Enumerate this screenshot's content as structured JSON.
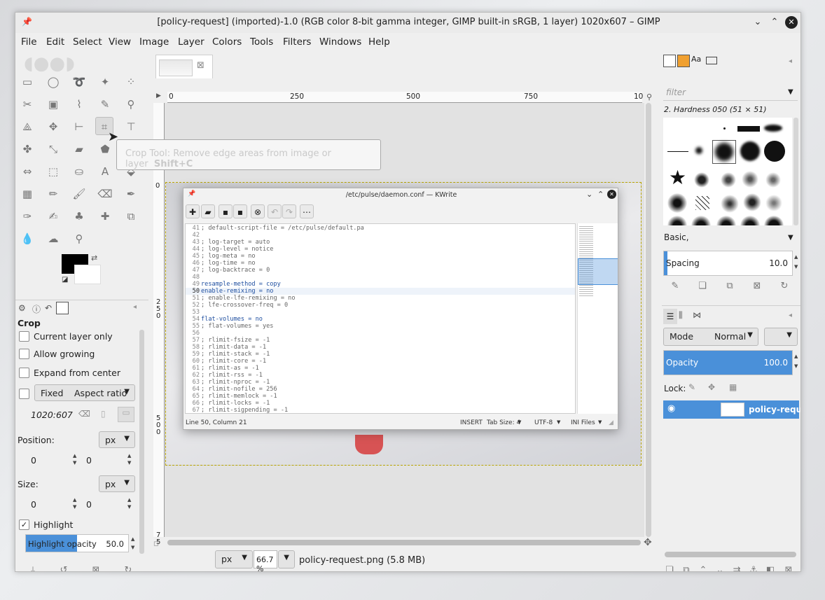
{
  "window": {
    "title": "[policy-request] (imported)-1.0 (RGB color 8-bit gamma integer, GIMP built-in sRGB, 1 layer) 1020x607 – GIMP"
  },
  "menubar": [
    "File",
    "Edit",
    "Select",
    "View",
    "Image",
    "Layer",
    "Colors",
    "Tools",
    "Filters",
    "Windows",
    "Help"
  ],
  "tooltip": {
    "text": "Crop Tool: Remove edge areas from image or layer",
    "shortcut": "Shift+C"
  },
  "tool_options": {
    "title": "Crop",
    "current_layer_only": "Current layer only",
    "allow_growing": "Allow growing",
    "expand_from_center": "Expand from center",
    "fixed": "Fixed",
    "fixed_mode": "Aspect ratio",
    "ratio": "1020:607",
    "position_label": "Position:",
    "position_unit": "px",
    "position_x": "0",
    "position_y": "0",
    "size_label": "Size:",
    "size_unit": "px",
    "size_w": "0",
    "size_h": "0",
    "highlight": "Highlight",
    "highlight_opacity_label": "Highlight opacity",
    "highlight_opacity_value": "50.0",
    "highlight_opacity_fraction": 0.5
  },
  "ruler": {
    "h_ticks": [
      "0",
      "250",
      "500",
      "750",
      "10"
    ],
    "v_ticks": [
      "0",
      "2\n5\n0",
      "5\n0\n0",
      "7\n5"
    ]
  },
  "statusbar": {
    "unit": "px",
    "zoom": "66.7 %",
    "filename": "policy-request.png (5.8 MB)"
  },
  "kwrite": {
    "title": "/etc/pulse/daemon.conf — KWrite",
    "lines": [
      {
        "n": "41",
        "t": "; default-script-file = /etc/pulse/default.pa"
      },
      {
        "n": "42",
        "t": ""
      },
      {
        "n": "43",
        "t": "; log-target = auto"
      },
      {
        "n": "44",
        "t": "; log-level = notice"
      },
      {
        "n": "45",
        "t": "; log-meta = no"
      },
      {
        "n": "46",
        "t": "; log-time = no"
      },
      {
        "n": "47",
        "t": "; log-backtrace = 0"
      },
      {
        "n": "48",
        "t": ""
      },
      {
        "n": "49",
        "t": "resample-method = copy"
      },
      {
        "n": "50",
        "t": "enable-remixing = no"
      },
      {
        "n": "51",
        "t": "; enable-lfe-remixing = no"
      },
      {
        "n": "52",
        "t": "; lfe-crossover-freq = 0"
      },
      {
        "n": "53",
        "t": ""
      },
      {
        "n": "54",
        "t": "flat-volumes = no"
      },
      {
        "n": "55",
        "t": "; flat-volumes = yes"
      },
      {
        "n": "56",
        "t": ""
      },
      {
        "n": "57",
        "t": "; rlimit-fsize = -1"
      },
      {
        "n": "58",
        "t": "; rlimit-data = -1"
      },
      {
        "n": "59",
        "t": "; rlimit-stack = -1"
      },
      {
        "n": "60",
        "t": "; rlimit-core = -1"
      },
      {
        "n": "61",
        "t": "; rlimit-as = -1"
      },
      {
        "n": "62",
        "t": "; rlimit-rss = -1"
      },
      {
        "n": "63",
        "t": "; rlimit-nproc = -1"
      },
      {
        "n": "64",
        "t": "; rlimit-nofile = 256"
      },
      {
        "n": "65",
        "t": "; rlimit-memlock = -1"
      },
      {
        "n": "66",
        "t": "; rlimit-locks = -1"
      },
      {
        "n": "67",
        "t": "; rlimit-sigpending = -1"
      }
    ],
    "status": {
      "position": "Line 50, Column 21",
      "mode": "INSERT",
      "tab_size": "Tab Size: 4",
      "encoding": "UTF-8",
      "syntax": "INI Files"
    }
  },
  "brushes": {
    "filter_placeholder": "filter",
    "selected": "2. Hardness 050 (51 × 51)",
    "preset": "Basic,",
    "spacing_label": "Spacing",
    "spacing_value": "10.0"
  },
  "layers": {
    "mode_label": "Mode",
    "mode_value": "Normal",
    "opacity_label": "Opacity",
    "opacity_value": "100.0",
    "lock_label": "Lock:",
    "layer_name": "policy-request"
  },
  "icons": {
    "pin": "pin-icon",
    "minimize": "chevron-down-icon",
    "maximize": "chevron-up-icon",
    "close": "close-icon"
  }
}
